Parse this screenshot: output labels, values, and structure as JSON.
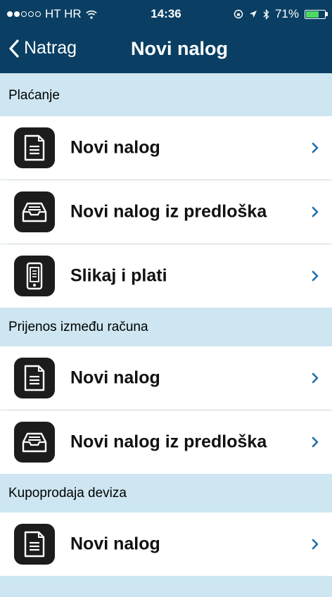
{
  "status_bar": {
    "carrier": "HT HR",
    "time": "14:36",
    "battery_percent": "71%",
    "battery_level": 0.71,
    "signal_bars_filled": 2,
    "signal_bars_total": 5,
    "icons": [
      "wifi-icon",
      "lock-rotation-icon",
      "location-icon",
      "bluetooth-icon",
      "battery-icon"
    ]
  },
  "nav": {
    "back_label": "Natrag",
    "title": "Novi nalog"
  },
  "sections": [
    {
      "header": "Plaćanje",
      "items": [
        {
          "label": "Novi nalog",
          "icon": "document-icon"
        },
        {
          "label": "Novi nalog iz predloška",
          "icon": "inbox-tray-icon"
        },
        {
          "label": "Slikaj i plati",
          "icon": "phone-camera-icon"
        }
      ]
    },
    {
      "header": "Prijenos između računa",
      "items": [
        {
          "label": "Novi nalog",
          "icon": "document-icon"
        },
        {
          "label": "Novi nalog iz predloška",
          "icon": "inbox-tray-icon"
        }
      ]
    },
    {
      "header": "Kupoprodaja deviza",
      "items": [
        {
          "label": "Novi nalog",
          "icon": "document-icon"
        }
      ]
    }
  ],
  "colors": {
    "nav_background": "#0a3f63",
    "section_background": "#cde6f1",
    "chevron": "#1f6fa8",
    "icon_background": "#1c1c1c"
  }
}
